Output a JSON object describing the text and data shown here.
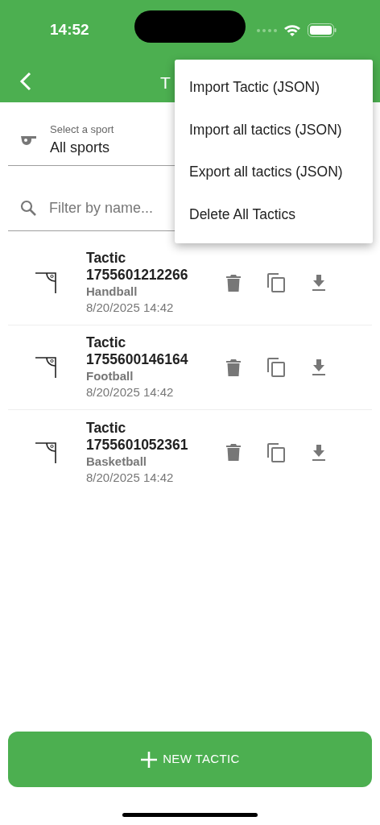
{
  "status_bar": {
    "time": "14:52"
  },
  "app_bar": {
    "title": "T"
  },
  "sport_select": {
    "label": "Select a sport",
    "value": "All sports"
  },
  "search": {
    "placeholder": "Filter by name..."
  },
  "tactics": [
    {
      "name": "Tactic\n1755601212266",
      "sport": "Handball",
      "date": "8/20/2025 14:42"
    },
    {
      "name": "Tactic\n1755600146164",
      "sport": "Football",
      "date": "8/20/2025 14:42"
    },
    {
      "name": "Tactic\n1755601052361",
      "sport": "Basketball",
      "date": "8/20/2025 14:42"
    }
  ],
  "menu": {
    "items": [
      "Import Tactic (JSON)",
      "Import all tactics (JSON)",
      "Export all tactics (JSON)",
      "Delete All Tactics"
    ]
  },
  "new_button": {
    "label": "NEW TACTIC"
  }
}
